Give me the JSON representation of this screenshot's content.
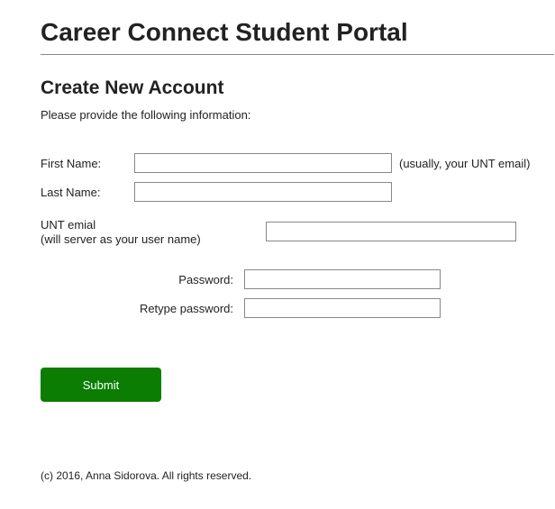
{
  "header": {
    "title": "Career Connect Student Portal"
  },
  "form": {
    "heading": "Create New Account",
    "instruction": "Please provide the following information:",
    "first_name": {
      "label": "First Name:",
      "value": "",
      "hint": "(usually, your UNT email)"
    },
    "last_name": {
      "label": "Last Name:",
      "value": ""
    },
    "email": {
      "label": "UNT emial\n(will server as your user name)",
      "value": ""
    },
    "password": {
      "label": "Password:",
      "value": ""
    },
    "password2": {
      "label": "Retype  password:",
      "value": ""
    },
    "submit_label": "Submit"
  },
  "footer": {
    "copyright": "(c) 2016, Anna Sidorova. All rights reserved."
  }
}
